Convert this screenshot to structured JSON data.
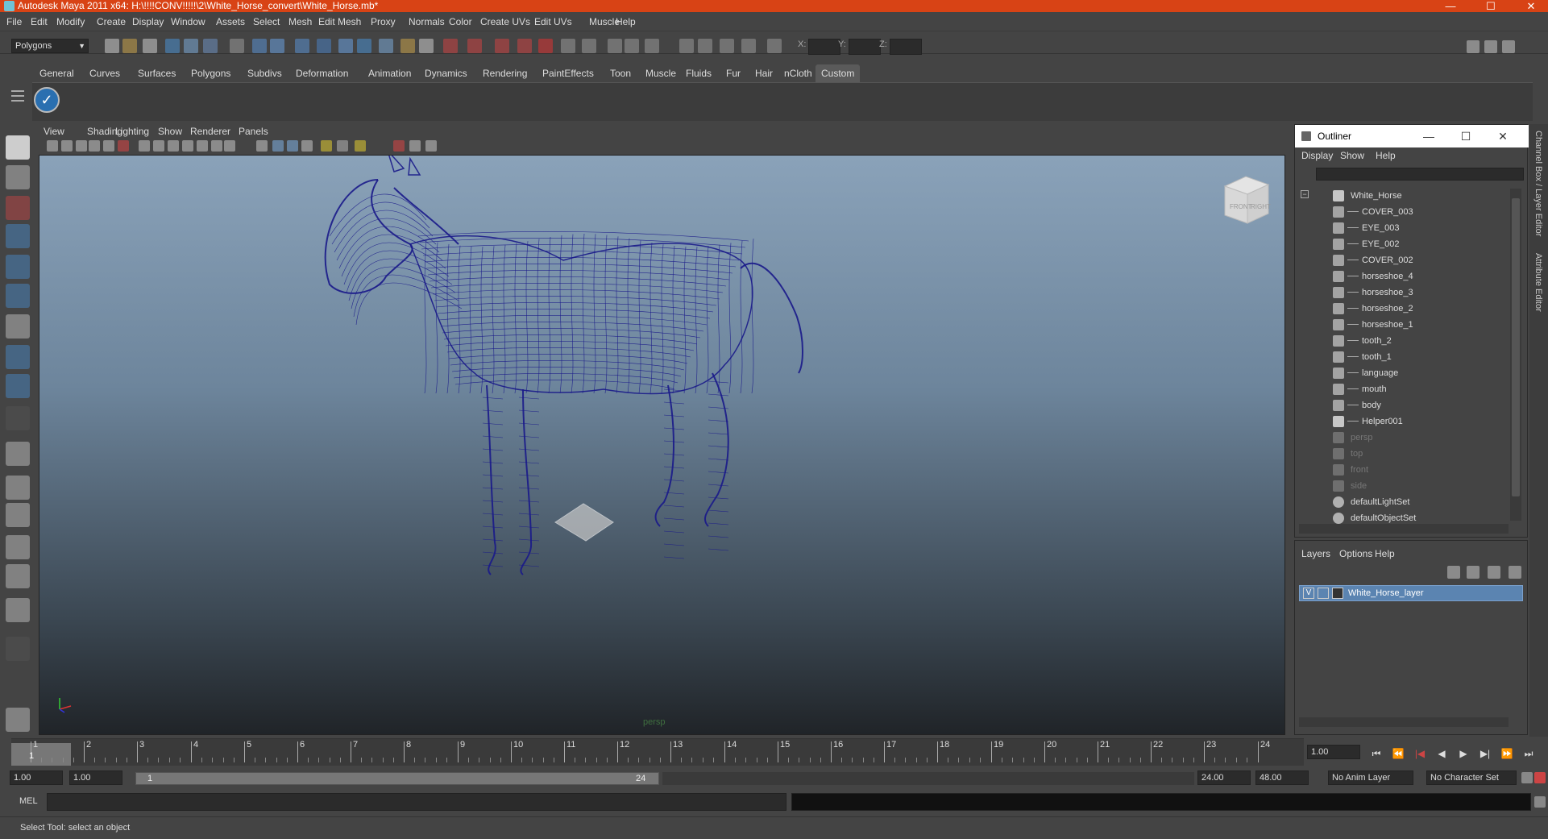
{
  "window": {
    "title": "Autodesk Maya 2011 x64: H:\\!!!!CONV!!!!!\\2\\White_Horse_convert\\White_Horse.mb*",
    "minimize": "—",
    "maximize": "☐",
    "close": "✕"
  },
  "menubar": [
    "File",
    "Edit",
    "Modify",
    "Create",
    "Display",
    "Window",
    "Assets",
    "Select",
    "Mesh",
    "Edit Mesh",
    "Proxy",
    "Normals",
    "Color",
    "Create UVs",
    "Edit UVs",
    "Muscle",
    "Help"
  ],
  "statusline": {
    "mode": "Polygons",
    "x_label": "X:",
    "y_label": "Y:",
    "z_label": "Z:"
  },
  "shelf_tabs": [
    "General",
    "Curves",
    "Surfaces",
    "Polygons",
    "Subdivs",
    "Deformation",
    "Animation",
    "Dynamics",
    "Rendering",
    "PaintEffects",
    "Toon",
    "Muscle",
    "Fluids",
    "Fur",
    "Hair",
    "nCloth",
    "Custom"
  ],
  "active_shelf": "Custom",
  "viewport": {
    "menu": [
      "View",
      "Shading",
      "Lighting",
      "Show",
      "Renderer",
      "Panels"
    ],
    "camera_label": "persp",
    "viewcube_front": "FRONT",
    "viewcube_right": "RIGHT",
    "wire_color": "#1a1a8a"
  },
  "outliner": {
    "title": "Outliner",
    "menu": [
      "Display",
      "Show",
      "Help"
    ],
    "items": [
      {
        "label": "White_Horse",
        "type": "transform",
        "dim": false,
        "indent": 0
      },
      {
        "label": "COVER_003",
        "type": "mesh",
        "dim": false,
        "indent": 1
      },
      {
        "label": "EYE_003",
        "type": "mesh",
        "dim": false,
        "indent": 1
      },
      {
        "label": "EYE_002",
        "type": "mesh",
        "dim": false,
        "indent": 1
      },
      {
        "label": "COVER_002",
        "type": "mesh",
        "dim": false,
        "indent": 1
      },
      {
        "label": "horseshoe_4",
        "type": "mesh",
        "dim": false,
        "indent": 1
      },
      {
        "label": "horseshoe_3",
        "type": "mesh",
        "dim": false,
        "indent": 1
      },
      {
        "label": "horseshoe_2",
        "type": "mesh",
        "dim": false,
        "indent": 1
      },
      {
        "label": "horseshoe_1",
        "type": "mesh",
        "dim": false,
        "indent": 1
      },
      {
        "label": "tooth_2",
        "type": "mesh",
        "dim": false,
        "indent": 1
      },
      {
        "label": "tooth_1",
        "type": "mesh",
        "dim": false,
        "indent": 1
      },
      {
        "label": "language",
        "type": "mesh",
        "dim": false,
        "indent": 1
      },
      {
        "label": "mouth",
        "type": "mesh",
        "dim": false,
        "indent": 1
      },
      {
        "label": "body",
        "type": "mesh",
        "dim": false,
        "indent": 1
      },
      {
        "label": "Helper001",
        "type": "helper",
        "dim": false,
        "indent": 1
      },
      {
        "label": "persp",
        "type": "camera",
        "dim": true,
        "indent": 0
      },
      {
        "label": "top",
        "type": "camera",
        "dim": true,
        "indent": 0
      },
      {
        "label": "front",
        "type": "camera",
        "dim": true,
        "indent": 0
      },
      {
        "label": "side",
        "type": "camera",
        "dim": true,
        "indent": 0
      },
      {
        "label": "defaultLightSet",
        "type": "set",
        "dim": false,
        "indent": 0
      },
      {
        "label": "defaultObjectSet",
        "type": "set",
        "dim": false,
        "indent": 0
      }
    ]
  },
  "layers": {
    "menu": [
      "Layers",
      "Options",
      "Help"
    ],
    "layer_visible": "V",
    "layer_name": "White_Horse_layer"
  },
  "side_tabs": {
    "channel_box": "Channel Box / Layer Editor",
    "attribute_editor": "Attribute Editor"
  },
  "timeline": {
    "ticks": [
      "1",
      "2",
      "3",
      "4",
      "5",
      "6",
      "7",
      "8",
      "9",
      "10",
      "11",
      "12",
      "13",
      "14",
      "15",
      "16",
      "17",
      "18",
      "19",
      "20",
      "21",
      "22",
      "23",
      "24"
    ],
    "current_frame": "1",
    "current_frame_field": "1.00"
  },
  "range": {
    "start": "1.00",
    "anim_start": "1.00",
    "slider_start": "1",
    "slider_end": "24",
    "anim_end": "24.00",
    "end": "48.00",
    "anim_layer": "No Anim Layer",
    "character_set": "No Character Set"
  },
  "cmdline": {
    "label": "MEL"
  },
  "helpline": {
    "text": "Select Tool: select an object"
  }
}
